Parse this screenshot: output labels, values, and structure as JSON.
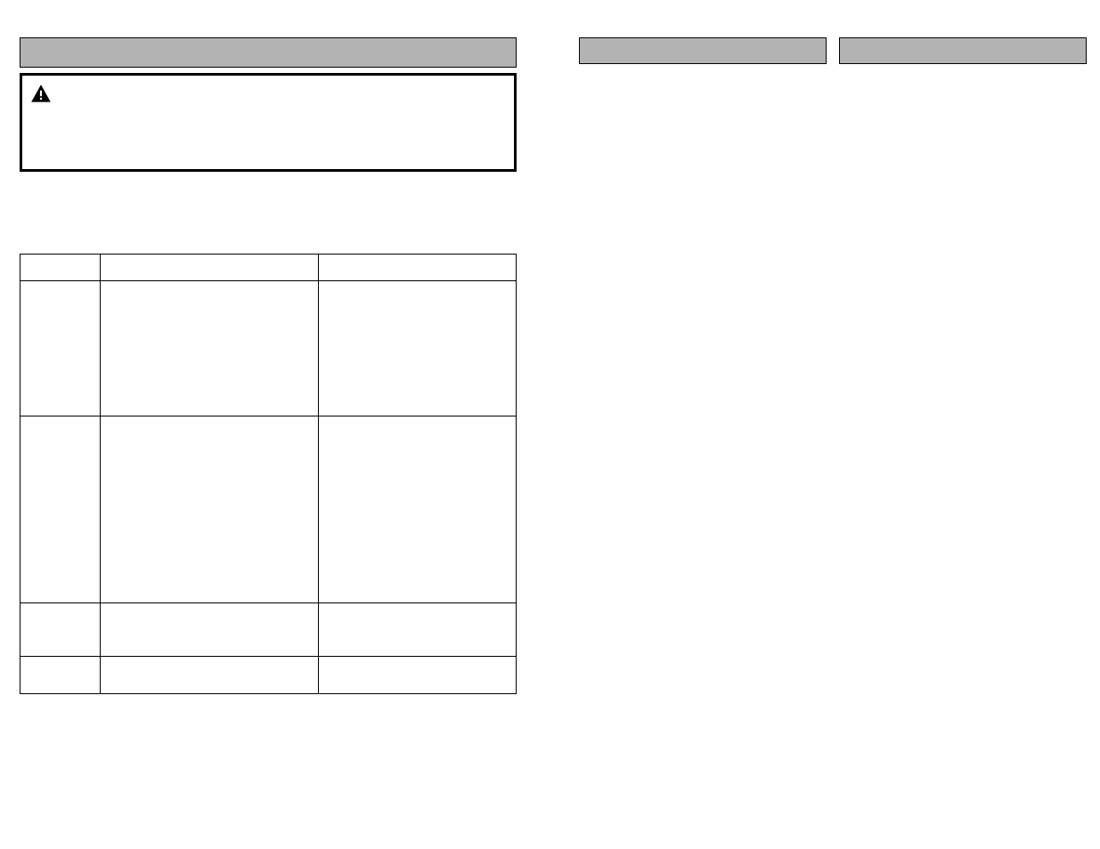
{
  "left": {
    "section_title": "",
    "warning_text": "",
    "intro_text": "",
    "table": {
      "headers": [
        "",
        "",
        ""
      ],
      "rows": [
        [
          "",
          "",
          ""
        ],
        [
          "",
          "",
          ""
        ],
        [
          "",
          "",
          ""
        ],
        [
          "",
          "",
          ""
        ]
      ]
    }
  },
  "right_a": {
    "section_title": ""
  },
  "right_b": {
    "section_title": ""
  }
}
